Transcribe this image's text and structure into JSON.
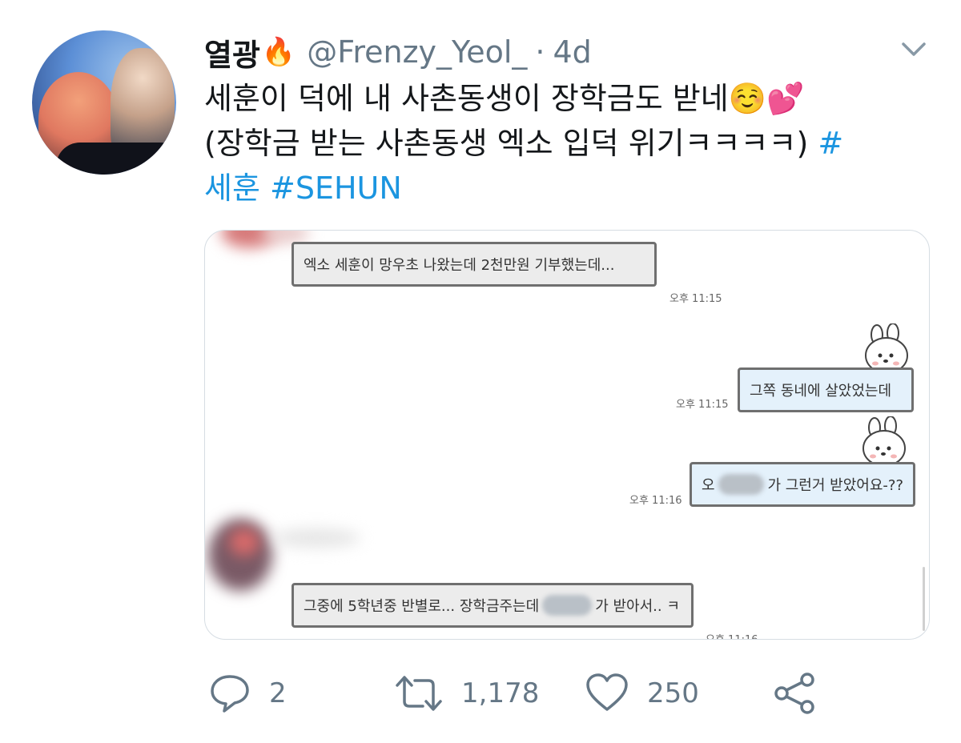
{
  "tweet": {
    "display_name": "열광",
    "handle": "@Frenzy_Yeol_",
    "time": "4d",
    "text_line1": "세훈이 덕에 내 사촌동생이 장학금도 받네☺️💕",
    "text_line2": "(장학금 받는 사촌동생 엑소 입덕 위기ㅋㅋㅋㅋ) ",
    "hashtag_line2": "#",
    "hashtag_line3a": "세훈",
    "hashtag_line3b": "#SEHUN"
  },
  "chat": {
    "msg1": "엑소 세훈이 망우초 나왔는데 2천만원 기부했는데...",
    "msg1_time": "오후 11:15",
    "msg2": "그쪽 동네에 살았었는데",
    "msg2_time": "오후 11:15",
    "msg3_prefix": "오",
    "msg3_suffix": "가 그런거 받았어요-??",
    "msg3_time": "오후 11:16",
    "msg4_prefix": "그중에 5학년중 반별로... 장학금주는데",
    "msg4_suffix": "가 받아서.. ㅋ",
    "msg4_time": "오후 11:16"
  },
  "actions": {
    "reply_count": "2",
    "retweet_count": "1,178",
    "like_count": "250"
  },
  "colors": {
    "link": "#1b95e0",
    "secondary_text": "#657786"
  },
  "icons": [
    "fire-icon",
    "chevron-down-icon",
    "reply-icon",
    "retweet-icon",
    "like-icon",
    "share-icon"
  ]
}
